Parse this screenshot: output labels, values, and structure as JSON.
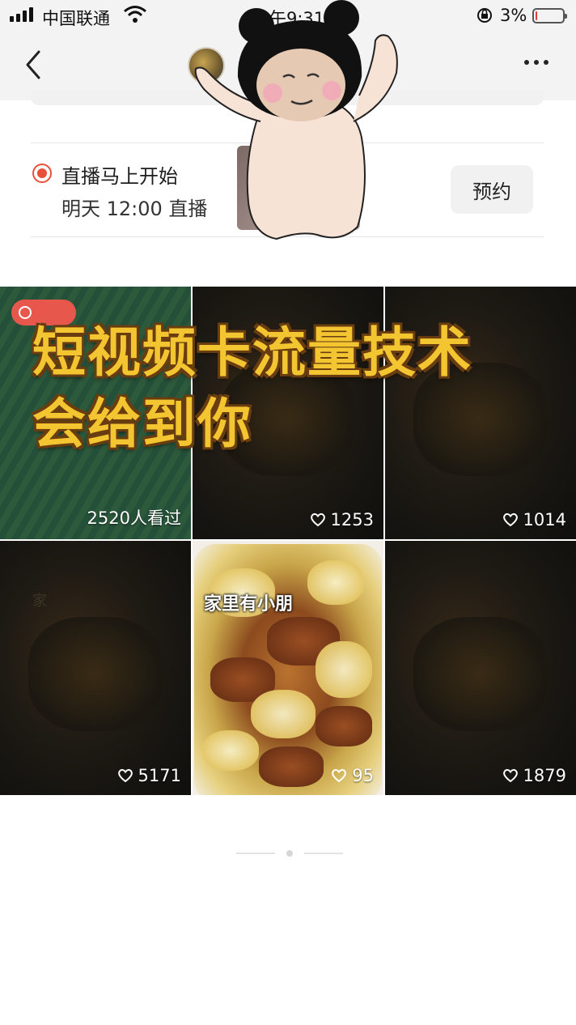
{
  "status_bar": {
    "carrier": "中国联通",
    "time": "上午9:31",
    "battery_percent": "3%",
    "battery_level": 0.03,
    "battery_color": "#e33b3b"
  },
  "nav": {
    "back_icon": "chevron-left-icon",
    "more_icon": "more-dots-icon"
  },
  "live": {
    "title": "直播马上开始",
    "subtitle": "明天 12:00 直播",
    "reserve_label": "预约",
    "accent": "#e8503a"
  },
  "overlay": {
    "line1": "短视频卡流量技术",
    "line2": "会给到你",
    "color": "#f3c530"
  },
  "grid": {
    "tiles": [
      {
        "kind": "green",
        "stat": "2520人看过",
        "icon": "",
        "badge": true
      },
      {
        "kind": "dark",
        "stat": "1253",
        "icon": "heart-icon"
      },
      {
        "kind": "dark",
        "stat": "1014",
        "icon": "heart-icon"
      },
      {
        "kind": "dark",
        "stat": "5171",
        "icon": "heart-icon",
        "faint": "家"
      },
      {
        "kind": "food",
        "stat": "95",
        "icon": "heart-icon",
        "caption": "家里有小朋"
      },
      {
        "kind": "dark",
        "stat": "1879",
        "icon": "heart-icon"
      }
    ]
  }
}
